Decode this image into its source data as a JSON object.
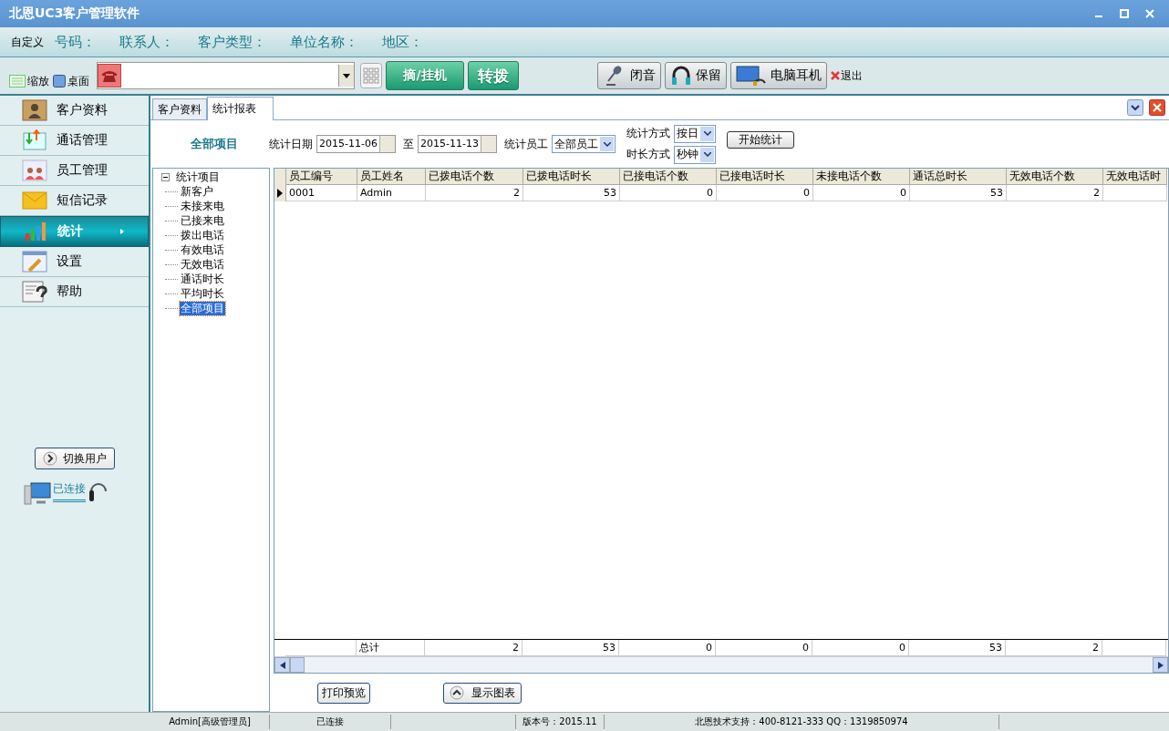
{
  "window": {
    "title": "北恩UC3客户管理软件"
  },
  "info_bar": {
    "label": "自定义",
    "fields": [
      "号码：",
      "联系人：",
      "客户类型：",
      "单位名称：",
      "地区："
    ]
  },
  "toolbar": {
    "zoom": "缩放",
    "desktop": "桌面",
    "call_buttons": [
      {
        "kind": "green",
        "label": "摘/挂机"
      },
      {
        "kind": "green",
        "label": "转拨"
      }
    ],
    "device_buttons": [
      {
        "kind": "mic",
        "label": "闭音"
      },
      {
        "kind": "headphones",
        "label": "保留"
      },
      {
        "kind": "pc-headset",
        "label": "电脑耳机"
      }
    ],
    "exit": "退出"
  },
  "sidebar": {
    "items": [
      {
        "kind": "contacts",
        "label": "客户资料",
        "selected": false
      },
      {
        "kind": "calls",
        "label": "通话管理",
        "selected": false
      },
      {
        "kind": "staff",
        "label": "员工管理",
        "selected": false
      },
      {
        "kind": "mail",
        "label": "短信记录",
        "selected": false
      },
      {
        "kind": "chart",
        "label": "统计",
        "selected": true
      },
      {
        "kind": "settings",
        "label": "设置",
        "selected": false
      },
      {
        "kind": "help",
        "label": "帮助",
        "selected": false
      }
    ],
    "switch_user": "切换用户",
    "connection": "已连接"
  },
  "tabs": [
    {
      "label": "客户资料",
      "selected": false
    },
    {
      "label": "统计报表",
      "selected": true
    }
  ],
  "filter": {
    "title": "全部项目",
    "date_label": "统计日期",
    "date_from": "2015-11-06",
    "to_label": "至",
    "date_to": "2015-11-13",
    "staff_label": "统计员工",
    "staff": "全部员工",
    "mode_label": "统计方式",
    "mode": "按日",
    "duration_label": "时长方式",
    "duration": "秒钟",
    "start": "开始统计"
  },
  "tree": {
    "label": "统计项目",
    "expanded": true,
    "children": [
      {
        "label": "新客户",
        "selected": false
      },
      {
        "label": "未接来电",
        "selected": false
      },
      {
        "label": "已接来电",
        "selected": false
      },
      {
        "label": "拨出电话",
        "selected": false
      },
      {
        "label": "有效电话",
        "selected": false
      },
      {
        "label": "无效电话",
        "selected": false
      },
      {
        "label": "通话时长",
        "selected": false
      },
      {
        "label": "平均时长",
        "selected": false
      },
      {
        "label": "全部项目",
        "selected": true
      }
    ]
  },
  "table": {
    "columns": [
      "员工编号",
      "员工姓名",
      "已拨电话个数",
      "已拨电话时长",
      "已接电话个数",
      "已接电话时长",
      "未接电话个数",
      "通话总时长",
      "无效电话个数",
      "无效电话时"
    ],
    "rows": [
      {
        "current": true,
        "cells": [
          "0001",
          "Admin",
          "2",
          "53",
          "0",
          "0",
          "0",
          "53",
          "2"
        ]
      }
    ],
    "totals": {
      "label": "总计",
      "values": [
        "2",
        "53",
        "0",
        "0",
        "0",
        "53",
        "2"
      ]
    }
  },
  "actions": {
    "print_preview": "打印预览",
    "show_chart": "显示图表"
  },
  "status_bar": [
    "Admin[高级管理员]",
    "已连接",
    "版本号：2015.11",
    "北恩技术支持：400-8121-333 QQ：1319850974"
  ]
}
